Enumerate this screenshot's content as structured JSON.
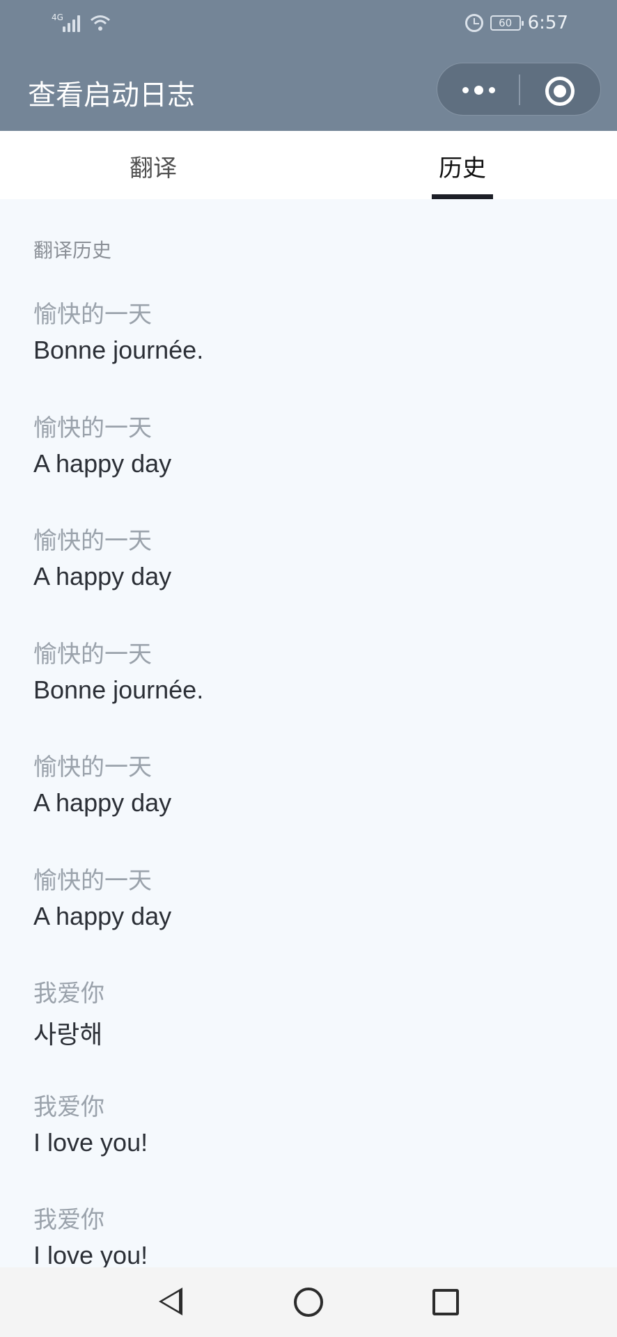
{
  "status_bar": {
    "network": "4G",
    "battery": "60",
    "time": "6:57"
  },
  "header": {
    "title": "查看启动日志"
  },
  "tabs": [
    {
      "label": "翻译",
      "active": false
    },
    {
      "label": "历史",
      "active": true
    }
  ],
  "history": {
    "section_label": "翻译历史",
    "items": [
      {
        "source": "愉快的一天",
        "translation": "Bonne journée."
      },
      {
        "source": "愉快的一天",
        "translation": "A happy day"
      },
      {
        "source": "愉快的一天",
        "translation": "A happy day"
      },
      {
        "source": "愉快的一天",
        "translation": "Bonne journée."
      },
      {
        "source": "愉快的一天",
        "translation": "A happy day"
      },
      {
        "source": "愉快的一天",
        "translation": "A happy day"
      },
      {
        "source": "我爱你",
        "translation": "사랑해"
      },
      {
        "source": "我爱你",
        "translation": "I love you!"
      },
      {
        "source": "我爱你",
        "translation": "I love you!"
      }
    ]
  },
  "colors": {
    "header_bg": "#748597",
    "content_bg": "#f5f9fd",
    "tab_indicator": "#1d1f27"
  }
}
